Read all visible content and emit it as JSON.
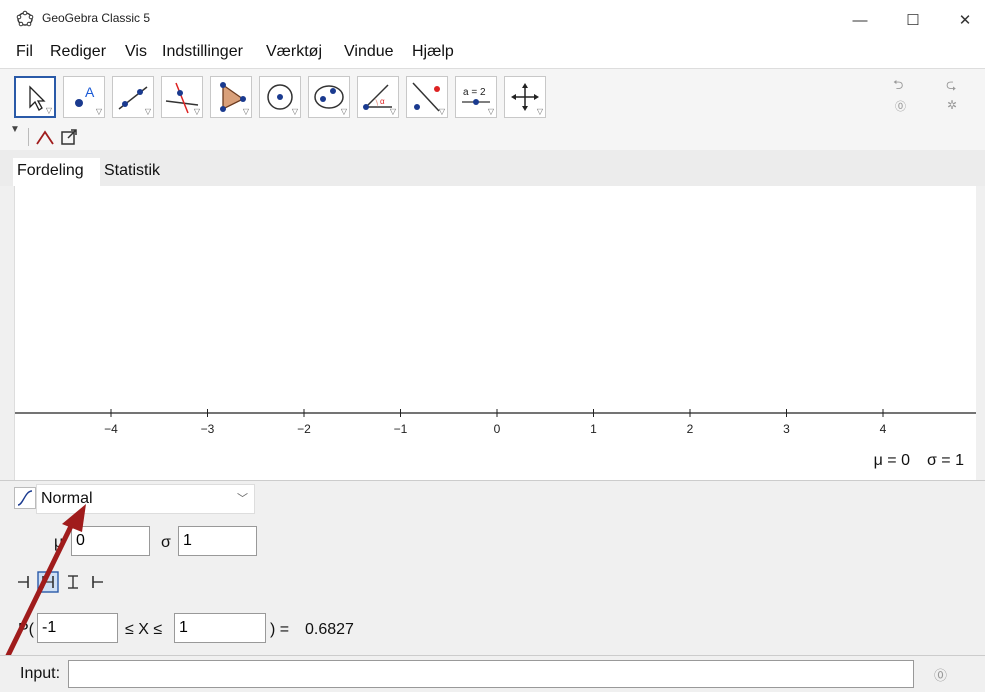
{
  "window": {
    "title": "GeoGebra Classic 5",
    "minimize": "—",
    "maximize": "☐",
    "close": "✕"
  },
  "menu": [
    "Fil",
    "Rediger",
    "Vis",
    "Indstillinger",
    "Værktøj",
    "Vindue",
    "Hjælp"
  ],
  "toolbar": {
    "tools": [
      "move-tool-icon",
      "point-tool-icon",
      "line-tool-icon",
      "perpendicular-tool-icon",
      "polygon-tool-icon",
      "circle-tool-icon",
      "conic-tool-icon",
      "angle-tool-icon",
      "reflect-tool-icon",
      "slider-tool-icon",
      "move-view-tool-icon"
    ],
    "slider_label": "a = 2"
  },
  "tabs": {
    "distribution": "Fordeling",
    "statistics": "Statistik"
  },
  "plot": {
    "x_ticks": [
      "−4",
      "−3",
      "−2",
      "−1",
      "0",
      "1",
      "2",
      "3",
      "4"
    ],
    "mu_label": "μ = 0",
    "sigma_label": "σ = 1"
  },
  "distribution": {
    "selected": "Normal",
    "mu_symbol": "μ",
    "mu_value": "0",
    "sigma_symbol": "σ",
    "sigma_value": "1"
  },
  "probability": {
    "prefix": "P(",
    "lower": "-1",
    "middle": "≤ X ≤",
    "upper": "1",
    "suffix": ") =",
    "result": "0.6827"
  },
  "inputbar": {
    "label": "Input:",
    "value": ""
  },
  "accent_color": "#a01c1c"
}
